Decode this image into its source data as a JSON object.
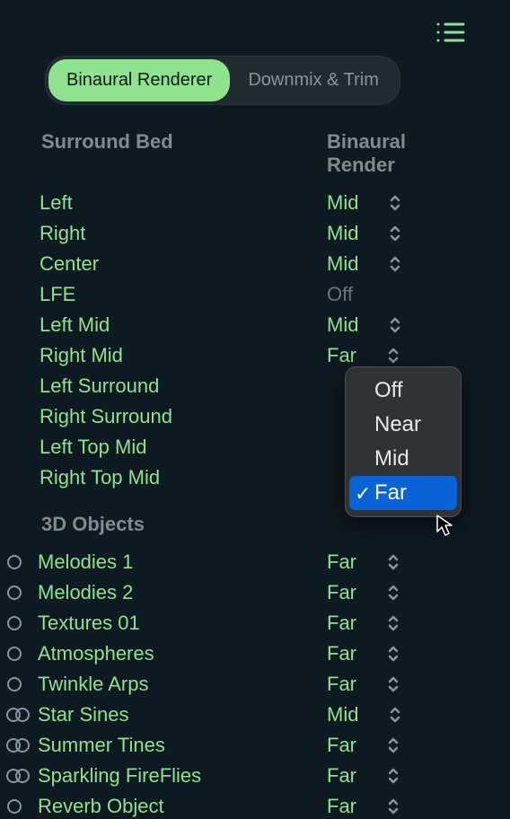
{
  "tabs": {
    "binaural": "Binaural Renderer",
    "downmix": "Downmix & Trim"
  },
  "headings": {
    "surround_bed": "Surround Bed",
    "binaural_render": "Binaural Render",
    "objects": "3D Objects"
  },
  "bed": [
    {
      "label": "Left",
      "value": "Mid",
      "stepper": true
    },
    {
      "label": "Right",
      "value": "Mid",
      "stepper": true
    },
    {
      "label": "Center",
      "value": "Mid",
      "stepper": true
    },
    {
      "label": "LFE",
      "value": "Off",
      "off": true,
      "stepper": false
    },
    {
      "label": "Left Mid",
      "value": "Mid",
      "stepper": true
    },
    {
      "label": "Right Mid",
      "value": "Far",
      "stepper": true
    },
    {
      "label": "Left Surround",
      "value": "",
      "stepper": false
    },
    {
      "label": "Right Surround",
      "value": "",
      "stepper": false
    },
    {
      "label": "Left Top Mid",
      "value": "",
      "stepper": false
    },
    {
      "label": "Right Top Mid",
      "value": "",
      "stepper": false
    }
  ],
  "objects": [
    {
      "label": "Melodies 1",
      "value": "Far",
      "kind": "mono"
    },
    {
      "label": "Melodies 2",
      "value": "Far",
      "kind": "mono"
    },
    {
      "label": "Textures 01",
      "value": "Far",
      "kind": "mono"
    },
    {
      "label": "Atmospheres",
      "value": "Far",
      "kind": "mono"
    },
    {
      "label": "Twinkle Arps",
      "value": "Far",
      "kind": "mono"
    },
    {
      "label": "Star Sines",
      "value": "Mid",
      "kind": "stereo"
    },
    {
      "label": "Summer Tines",
      "value": "Far",
      "kind": "stereo"
    },
    {
      "label": "Sparkling FireFlies",
      "value": "Far",
      "kind": "stereo"
    },
    {
      "label": "Reverb Object",
      "value": "Far",
      "kind": "mono"
    }
  ],
  "dropdown": {
    "options": [
      "Off",
      "Near",
      "Mid",
      "Far"
    ],
    "selected": "Far"
  }
}
